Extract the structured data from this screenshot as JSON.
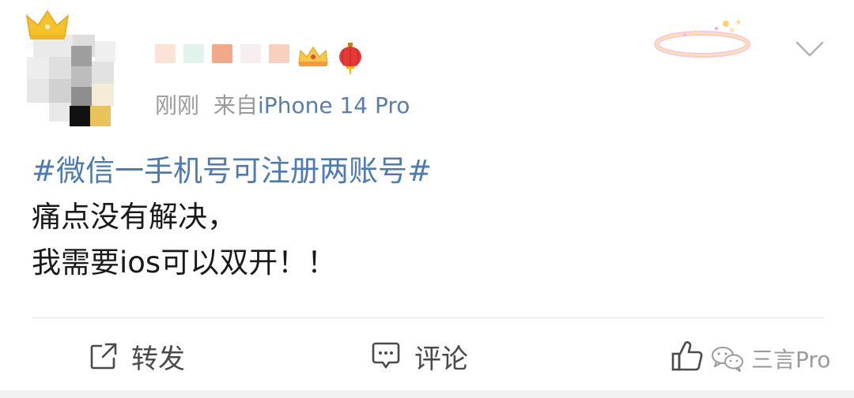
{
  "post": {
    "meta": {
      "time": "刚刚",
      "source_prefix": "来自",
      "source_device": "iPhone 14 Pro"
    },
    "content": {
      "hashtag": "#微信一手机号可注册两账号#",
      "line2": "痛点没有解决，",
      "line3": "我需要ios可以双开！！"
    },
    "actions": {
      "repost_label": "转发",
      "comment_label": "评论"
    },
    "watermark": "三言Pro",
    "icons": {
      "crown": "crown-icon",
      "vip": "vip-badge-icon",
      "lantern": "lantern-icon",
      "chevron": "chevron-down-icon",
      "repost": "share-icon",
      "comment": "comment-icon",
      "like": "thumbs-up-icon",
      "wechat": "wechat-icon"
    },
    "colors": {
      "hashtag": "#4c7ab5",
      "device": "#5b7ea8",
      "meta": "#9a9a9a",
      "text": "#1a1a1a"
    }
  }
}
